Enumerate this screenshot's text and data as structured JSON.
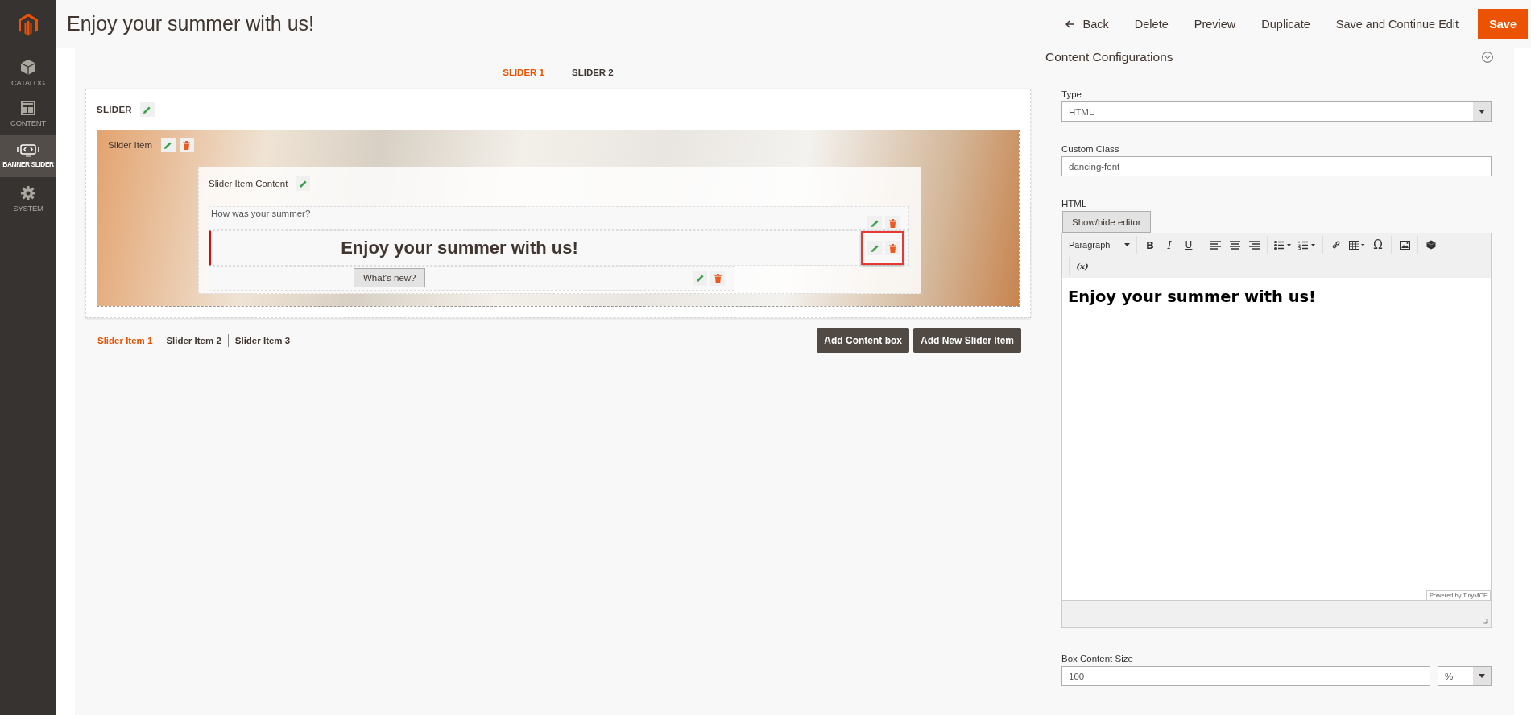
{
  "sidebar": {
    "items": [
      {
        "label": "CATALOG",
        "selected": false
      },
      {
        "label": "CONTENT",
        "selected": false
      },
      {
        "label": "BANNER SLIDER",
        "selected": true
      },
      {
        "label": "SYSTEM",
        "selected": false
      }
    ]
  },
  "header": {
    "title": "Enjoy your summer with us!",
    "actions": [
      {
        "label": "Back",
        "kind": "back"
      },
      {
        "label": "Delete",
        "kind": "link"
      },
      {
        "label": "Preview",
        "kind": "link"
      },
      {
        "label": "Duplicate",
        "kind": "link"
      },
      {
        "label": "Save and Continue Edit",
        "kind": "link"
      },
      {
        "label": "Save",
        "kind": "primary"
      }
    ]
  },
  "slider_tabs": [
    {
      "label": "SLIDER 1",
      "selected": true
    },
    {
      "label": "SLIDER 2",
      "selected": false
    }
  ],
  "slider": {
    "label": "SLIDER",
    "item_label": "Slider Item",
    "content_label": "Slider Item Content",
    "rows": [
      {
        "kind": "text",
        "text": "How was your summer?",
        "selected": false,
        "highlighted": false
      },
      {
        "kind": "heading",
        "text": "Enjoy your summer with us!",
        "selected": true,
        "highlighted": true
      },
      {
        "kind": "button",
        "text": "What's new?",
        "selected": false,
        "highlighted": false
      }
    ]
  },
  "item_tabs": [
    {
      "label": "Slider Item 1",
      "selected": true
    },
    {
      "label": "Slider Item 2",
      "selected": false
    },
    {
      "label": "Slider Item 3",
      "selected": false
    }
  ],
  "slider_actions": [
    "Add Content box",
    "Add New Slider Item"
  ],
  "config": {
    "title": "Content Configurations",
    "type": {
      "label": "Type",
      "value": "HTML"
    },
    "custom_class": {
      "label": "Custom Class",
      "value": "dancing-font"
    },
    "html": {
      "label": "HTML",
      "toggle": "Show/hide editor",
      "format": "Paragraph",
      "toolbar_text": [
        "B",
        "I",
        "U",
        "Ω",
        "(x)"
      ],
      "content": "Enjoy your summer with us!",
      "powered_by": "Powered by TinyMCE"
    },
    "box_size": {
      "label": "Box Content Size",
      "value": "100",
      "unit": "%"
    }
  }
}
